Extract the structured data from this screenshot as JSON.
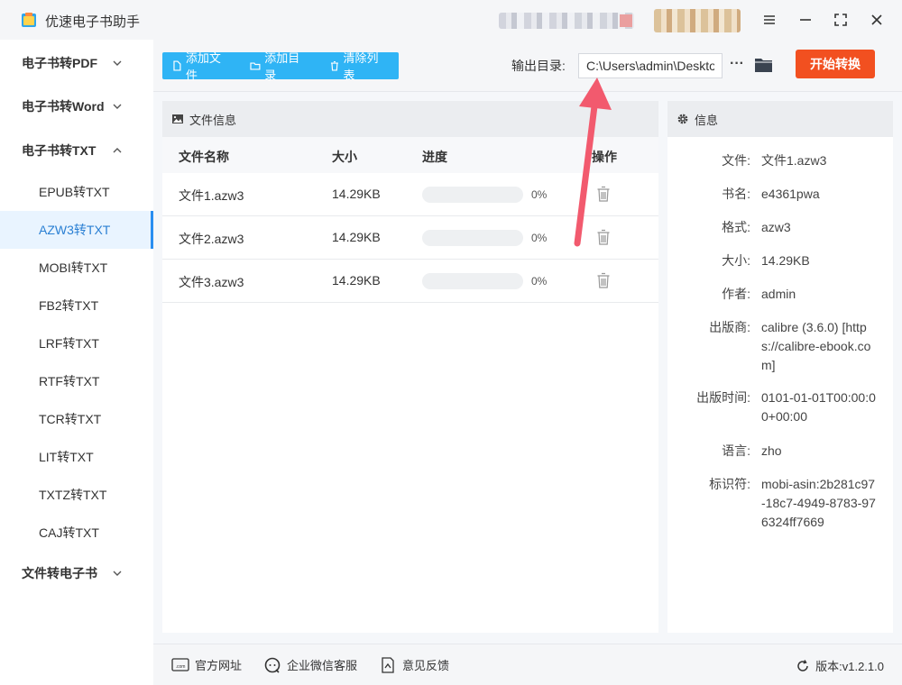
{
  "app": {
    "title": "优速电子书助手"
  },
  "colors": {
    "accent": "#2fb4f5",
    "start": "#f25020",
    "active_nav_bg": "#e9f4ff",
    "annotation_arrow": "#f25a6e"
  },
  "sidebar": {
    "groups": [
      {
        "label": "电子书转PDF",
        "expanded": false
      },
      {
        "label": "电子书转Word",
        "expanded": false
      },
      {
        "label": "电子书转TXT",
        "expanded": true
      },
      {
        "label": "文件转电子书",
        "expanded": false
      }
    ],
    "items": [
      {
        "label": "EPUB转TXT",
        "active": false
      },
      {
        "label": "AZW3转TXT",
        "active": true
      },
      {
        "label": "MOBI转TXT",
        "active": false
      },
      {
        "label": "FB2转TXT",
        "active": false
      },
      {
        "label": "LRF转TXT",
        "active": false
      },
      {
        "label": "RTF转TXT",
        "active": false
      },
      {
        "label": "TCR转TXT",
        "active": false
      },
      {
        "label": "LIT转TXT",
        "active": false
      },
      {
        "label": "TXTZ转TXT",
        "active": false
      },
      {
        "label": "CAJ转TXT",
        "active": false
      }
    ]
  },
  "toolbar": {
    "add_file": "添加文件",
    "add_folder": "添加目录",
    "clear_list": "清除列表",
    "output_label": "输出目录:",
    "output_value": "C:\\Users\\admin\\Deskto",
    "more": "···",
    "start": "开始转换"
  },
  "file_panel": {
    "title": "文件信息",
    "columns": {
      "name": "文件名称",
      "size": "大小",
      "progress": "进度",
      "action": "操作"
    },
    "rows": [
      {
        "name": "文件1.azw3",
        "size": "14.29KB",
        "progress": 0,
        "progress_text": "0%"
      },
      {
        "name": "文件2.azw3",
        "size": "14.29KB",
        "progress": 0,
        "progress_text": "0%"
      },
      {
        "name": "文件3.azw3",
        "size": "14.29KB",
        "progress": 0,
        "progress_text": "0%"
      }
    ]
  },
  "info_panel": {
    "title": "信息",
    "rows": [
      {
        "key": "文件:",
        "value": "文件1.azw3"
      },
      {
        "key": "书名:",
        "value": "e4361pwa"
      },
      {
        "key": "格式:",
        "value": "azw3"
      },
      {
        "key": "大小:",
        "value": "14.29KB"
      },
      {
        "key": "作者:",
        "value": "admin"
      },
      {
        "key": "出版商:",
        "value": "calibre (3.6.0) [https://calibre-ebook.com]"
      },
      {
        "key": "出版时间:",
        "value": "0101-01-01T00:00:00+00:00"
      },
      {
        "key": "语言:",
        "value": "zho"
      },
      {
        "key": "标识符:",
        "value": "mobi-asin:2b281c97-18c7-4949-8783-976324ff7669"
      }
    ]
  },
  "footer": {
    "website": "官方网址",
    "wechat": "企业微信客服",
    "feedback": "意见反馈",
    "version": "版本:v1.2.1.0"
  }
}
